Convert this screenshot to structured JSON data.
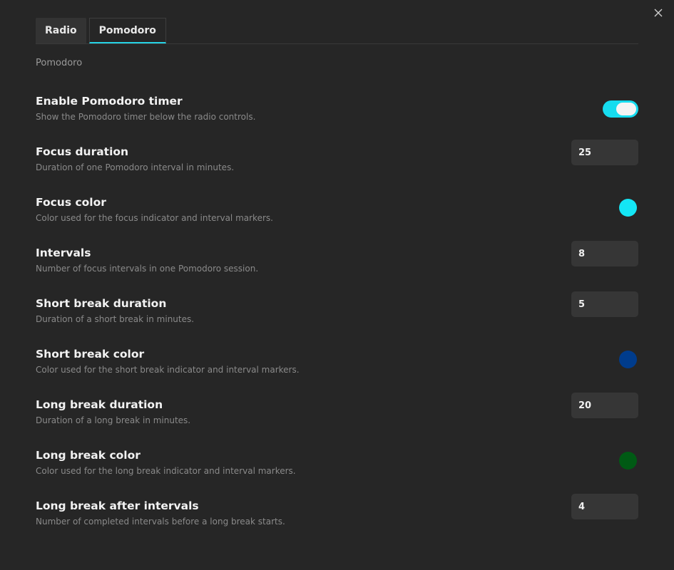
{
  "tabs": [
    {
      "label": "Radio",
      "active": false
    },
    {
      "label": "Pomodoro",
      "active": true
    }
  ],
  "section_title": "Pomodoro",
  "settings": {
    "enable": {
      "label": "Enable Pomodoro timer",
      "desc": "Show the Pomodoro timer below the radio controls.",
      "value": true
    },
    "focus_duration": {
      "label": "Focus duration",
      "desc": "Duration of one Pomodoro interval in minutes.",
      "value": "25"
    },
    "focus_color": {
      "label": "Focus color",
      "desc": "Color used for the focus indicator and interval markers.",
      "color": "#14e6f5"
    },
    "intervals": {
      "label": "Intervals",
      "desc": "Number of focus intervals in one Pomodoro session.",
      "value": "8"
    },
    "short_break_duration": {
      "label": "Short break duration",
      "desc": "Duration of a short break in minutes.",
      "value": "5"
    },
    "short_break_color": {
      "label": "Short break color",
      "desc": "Color used for the short break indicator and interval markers.",
      "color": "#003c8c"
    },
    "long_break_duration": {
      "label": "Long break duration",
      "desc": "Duration of a long break in minutes.",
      "value": "20"
    },
    "long_break_color": {
      "label": "Long break color",
      "desc": "Color used for the long break indicator and interval markers.",
      "color": "#005a14"
    },
    "long_break_after": {
      "label": "Long break after intervals",
      "desc": "Number of completed intervals before a long break starts.",
      "value": "4"
    }
  },
  "colors": {
    "accent": "#16dcef",
    "background": "#262626"
  },
  "icons": {
    "close": "close-icon"
  }
}
